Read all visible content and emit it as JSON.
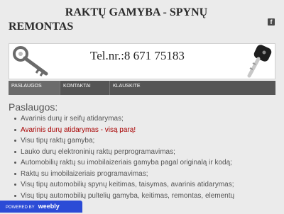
{
  "site": {
    "title_line1": "RAKTŲ GAMYBA - SPYNŲ",
    "title_line2": "REMONTAS",
    "facebook_icon": "f"
  },
  "banner": {
    "phone": "Tel.nr.:8 671 75183",
    "left_icon": "key-icon",
    "right_icon": "car-key-icon"
  },
  "nav": {
    "items": [
      {
        "label": "PASLAUGOS",
        "active": true
      },
      {
        "label": "KONTAKTAI",
        "active": false
      },
      {
        "label": "KLAUSKITE",
        "active": false
      }
    ]
  },
  "main": {
    "section_title": "Paslaugos:",
    "services": [
      "Avarinis durų ir seifų atidarymas;",
      "Avarinis durų atidarymas - visą parą!",
      "Visu tipų raktų gamyba;",
      "Lauko durų elektroninių raktų perprogramavimas;",
      "Automobilių raktų su imobilaizeriais gamyba pagal originalą ir kodą;",
      "Raktų su imobilaizeriais programavimas;",
      "Visų tipų automobilių spynų keitimas, taisymas, avarinis atidarymas;",
      "Visų tipų automobilių pultelių gamyba, keitimas, remontas, elementų"
    ],
    "highlight_color": "#a80000"
  },
  "footer": {
    "powered_by": "POWERED BY",
    "brand": "weebly",
    "badge_color": "#2b4bd6"
  }
}
